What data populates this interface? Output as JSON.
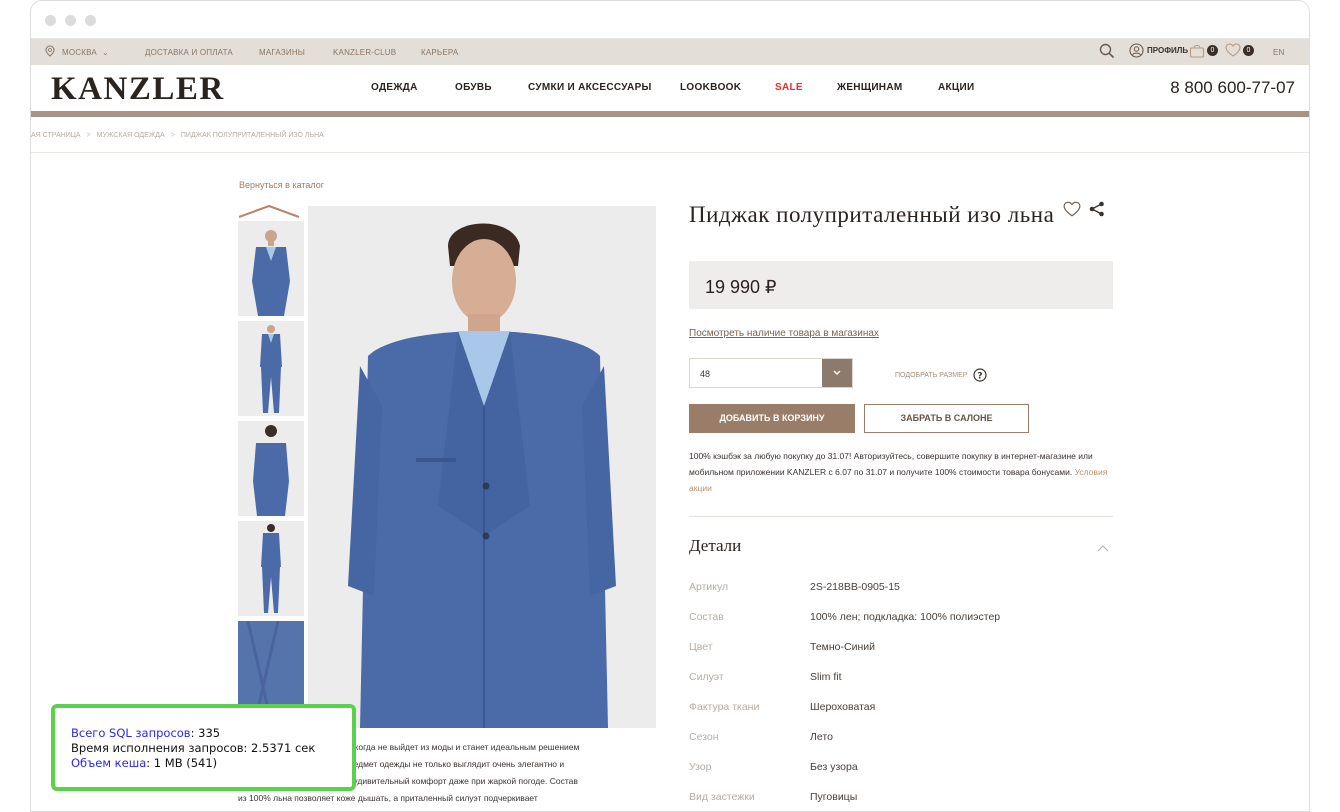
{
  "topbar": {
    "city": "МОСКВА",
    "links": [
      "ДОСТАВКА И ОПЛАТА",
      "МАГАЗИНЫ",
      "KANZLER-CLUB",
      "КАРЬЕРА"
    ],
    "profile": "ПРОФИЛЬ",
    "cart_count": "0",
    "favorites_count": "0",
    "lang": "EN"
  },
  "nav": {
    "logo": "KANZLER",
    "items": [
      "ОДЕЖДА",
      "ОБУВЬ",
      "СУМКИ И АКСЕССУАРЫ",
      "LOOKBOOK",
      "SALE",
      "ЖЕНЩИНАМ",
      "АКЦИИ"
    ],
    "phone": "8 800 600-77-07",
    "sale_color": "#e0322e"
  },
  "breadcrumb": [
    "АЯ СТРАНИЦА",
    "МУЖСКАЯ ОДЕЖДА",
    "ПИДЖАК ПОЛУПРИТАЛЕННЫЙ ИЗО ЛЬНА"
  ],
  "product": {
    "back": "Вернуться в каталог",
    "title": "Пиджак полуприталенный изо льна",
    "price": "19 990 ₽",
    "availability": "Посмотреть наличие товара в магазинах",
    "size_value": "48",
    "size_pick": "ПОДОБРАТЬ РАЗМЕР",
    "add_to_cart": "ДОБАВИТЬ В КОРЗИНУ",
    "pickup": "ЗАБРАТЬ В САЛОНЕ",
    "promo_text": "100% кэшбэк за любую покупку до 31.07! Авторизуйтесь, совершите покупку в интернет-магазине или мобильном приложении KANZLER с 6.07 по 31.07 и получите 100% стоимости товара бонусами.",
    "promo_link": "Условия акции",
    "description_lines": [
      "й никогда не выйдет из моды и станет идеальным решением",
      "т предмет одежды не только выглядит очень элегантно и",
      "ает удивительный комфорт даже при жаркой погоде. Состав",
      "из 100% льна позволяет коже дышать, а приталенный силуэт подчеркивает"
    ]
  },
  "details": {
    "heading": "Детали",
    "rows": [
      {
        "k": "Артикул",
        "v": "2S-218BB-0905-15"
      },
      {
        "k": "Состав",
        "v": "100% лен; подкладка: 100% полиэстер"
      },
      {
        "k": "Цвет",
        "v": "Темно-Синий"
      },
      {
        "k": "Силуэт",
        "v": "Slim fit"
      },
      {
        "k": "Фактура ткани",
        "v": "Шероховатая"
      },
      {
        "k": "Сезон",
        "v": "Лето"
      },
      {
        "k": "Узор",
        "v": "Без узора"
      },
      {
        "k": "Вид застежки",
        "v": "Пуговицы"
      }
    ]
  },
  "debug": {
    "sql_label": "Всего SQL запросов",
    "sql_value": ": 335",
    "time_text": "Время исполнения запросов: 2.5371 сек",
    "cache_label": "Объем кеша",
    "cache_value": ": 1 MB (541)"
  }
}
